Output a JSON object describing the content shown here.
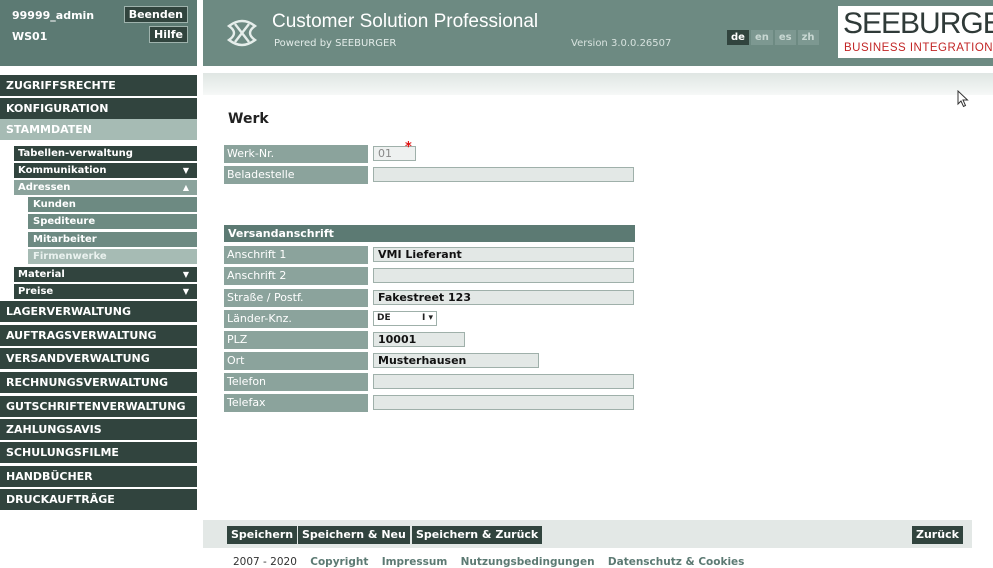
{
  "header": {
    "user": "99999_admin",
    "workstation": "WS01",
    "logout_label": "Beenden",
    "help_label": "Hilfe",
    "app_title": "Customer Solution Professional",
    "app_subtitle": "Powered by SEEBURGER",
    "version": "Version 3.0.0.26507",
    "languages": [
      "de",
      "en",
      "es",
      "zh"
    ],
    "active_language": "de",
    "brand_name": "SEEBURGER",
    "brand_tagline": "BUSINESS INTEGRATION"
  },
  "sidebar": {
    "items": [
      {
        "label": "ZUGRIFFSRECHTE"
      },
      {
        "label": "KONFIGURATION"
      },
      {
        "label": "STAMMDATEN"
      },
      {
        "label": "LAGERVERWALTUNG"
      },
      {
        "label": "AUFTRAGSVERWALTUNG"
      },
      {
        "label": "VERSANDVERWALTUNG"
      },
      {
        "label": "RECHNUNGSVERWALTUNG"
      },
      {
        "label": "GUTSCHRIFTENVERWALTUNG"
      },
      {
        "label": "ZAHLUNGSAVIS"
      },
      {
        "label": "SCHULUNGSFILME"
      },
      {
        "label": "HANDBÜCHER"
      },
      {
        "label": "DRUCKAUFTRÄGE"
      }
    ],
    "stammdaten_sub": [
      {
        "label": "Tabellen-verwaltung",
        "arrow": ""
      },
      {
        "label": "Kommunikation",
        "arrow": "▼"
      },
      {
        "label": "Adressen",
        "arrow": "▲"
      },
      {
        "label": "Material",
        "arrow": "▼"
      },
      {
        "label": "Preise",
        "arrow": "▼"
      }
    ],
    "adressen_sub": [
      {
        "label": "Kunden"
      },
      {
        "label": "Spediteure"
      },
      {
        "label": "Mitarbeiter"
      },
      {
        "label": "Firmenwerke"
      }
    ]
  },
  "page": {
    "title": "Werk",
    "werk_nr_label": "Werk-Nr.",
    "werk_nr_value": "01",
    "required_mark": "*",
    "beladestelle_label": "Beladestelle",
    "beladestelle_value": "",
    "section_title": "Versandanschrift",
    "address": {
      "anschrift1_label": "Anschrift 1",
      "anschrift1_value": "VMI Lieferant",
      "anschrift2_label": "Anschrift 2",
      "anschrift2_value": "",
      "strasse_label": "Straße / Postf.",
      "strasse_value": "Fakestreet 123",
      "land_label": "Länder-Knz.",
      "land_value": "DE",
      "plz_label": "PLZ",
      "plz_value": "10001",
      "ort_label": "Ort",
      "ort_value": "Musterhausen",
      "telefon_label": "Telefon",
      "telefon_value": "",
      "telefax_label": "Telefax",
      "telefax_value": ""
    }
  },
  "buttons": {
    "save": "Speichern",
    "save_new": "Speichern & Neu",
    "save_back": "Speichern & Zurück",
    "back": "Zurück"
  },
  "footer": {
    "years": "2007 - 2020",
    "links": [
      "Copyright",
      "Impressum",
      "Nutzungsbedingungen",
      "Datenschutz & Cookies"
    ]
  }
}
